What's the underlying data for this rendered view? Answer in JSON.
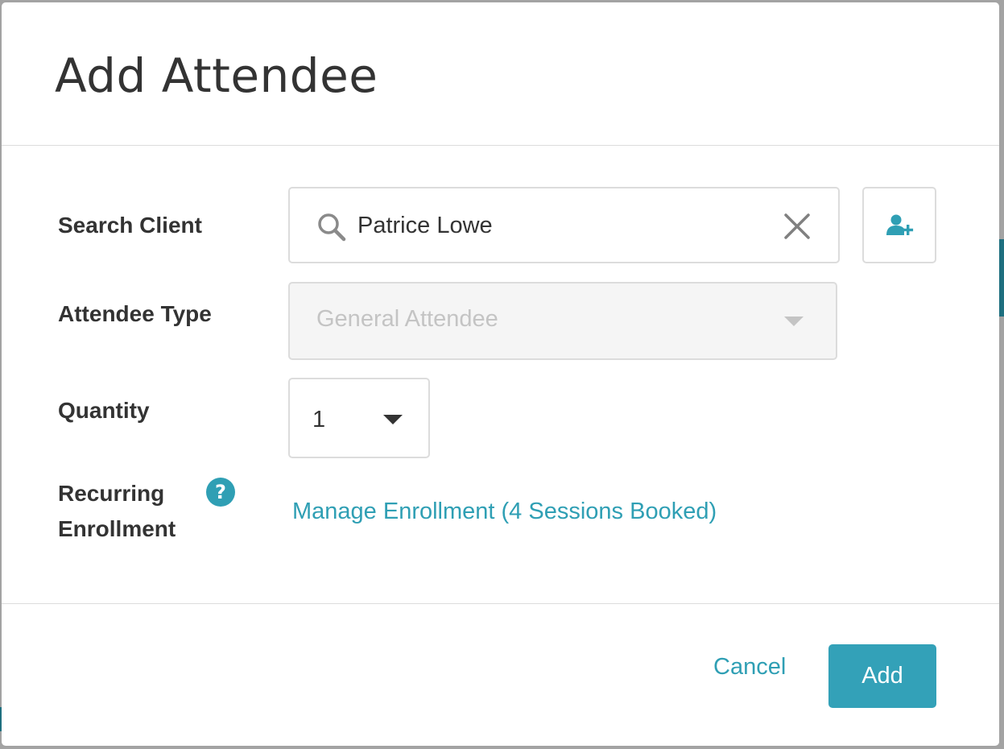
{
  "modal": {
    "title": "Add Attendee"
  },
  "form": {
    "search_client": {
      "label": "Search Client",
      "value": "Patrice Lowe",
      "search_icon": "search-icon",
      "clear_icon": "close-icon"
    },
    "add_client_icon": "add-user-icon",
    "attendee_type": {
      "label": "Attendee Type",
      "value": "General Attendee",
      "disabled": true
    },
    "quantity": {
      "label": "Quantity",
      "value": "1"
    },
    "recurring": {
      "label": "Recurring Enrollment",
      "help_icon": "question-circle-icon",
      "link": "Manage Enrollment (4 Sessions Booked)"
    }
  },
  "footer": {
    "cancel_label": "Cancel",
    "add_label": "Add"
  },
  "colors": {
    "accent": "#33a1b8",
    "link": "#2f9fb4",
    "text": "#333333",
    "border": "#dcdcdc",
    "disabled_bg": "#f5f5f5",
    "disabled_text": "#c4c4c4"
  }
}
